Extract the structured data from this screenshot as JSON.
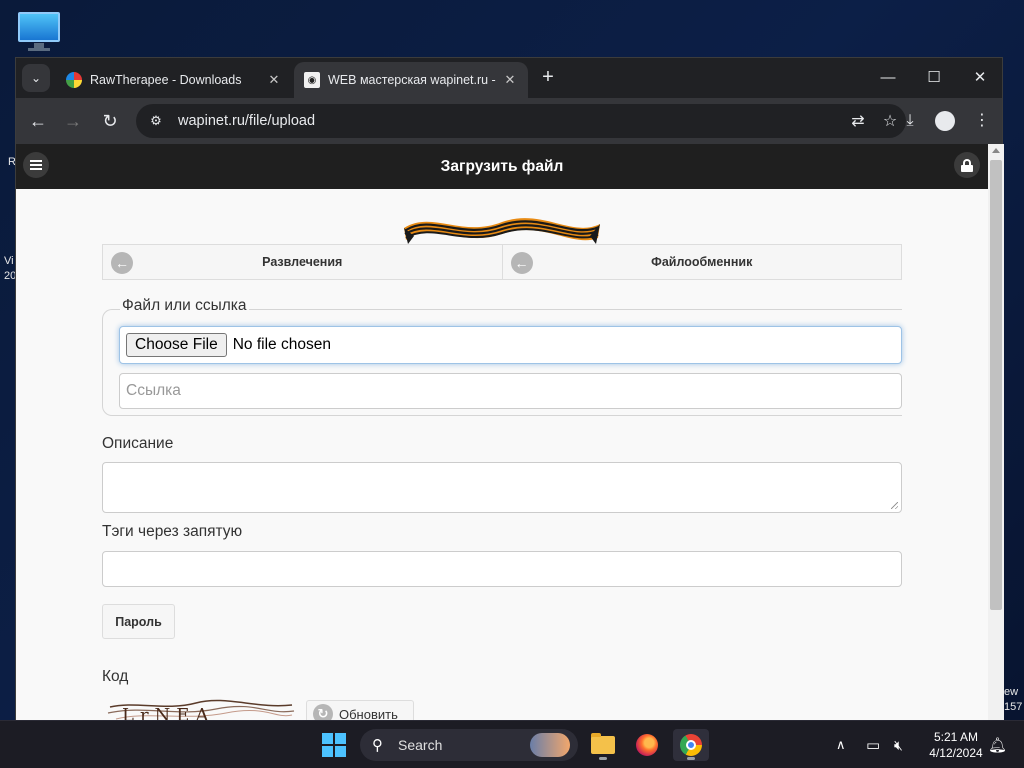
{
  "desktop": {
    "left_fragments": [
      "R",
      "Vi",
      "20"
    ],
    "right_fragments": [
      "ew",
      "157"
    ]
  },
  "browser": {
    "tabs": [
      {
        "title": "RawTherapee - Downloads",
        "close": "✕"
      },
      {
        "title": "WEB мастерская wapinet.ru - З",
        "close": "✕"
      }
    ],
    "new_tab": "+",
    "window_controls": {
      "minimize": "—",
      "maximize": "☐",
      "close": "✕"
    },
    "address": "wapinet.ru/file/upload"
  },
  "page": {
    "title": "Загрузить файл",
    "nav": [
      {
        "label": "Развлечения"
      },
      {
        "label": "Файлообменник"
      }
    ],
    "file_legend": "Файл или ссылка",
    "choose_file_label": "Choose File",
    "file_status": "No file chosen",
    "link_placeholder": "Ссылка",
    "description_label": "Описание",
    "tags_label": "Тэги через запятую",
    "password_button": "Пароль",
    "code_label": "Код",
    "refresh_label": "Обновить"
  },
  "taskbar": {
    "search_label": "Search",
    "time": "5:21 AM",
    "date": "4/12/2024"
  },
  "colors": {
    "header_bg": "#1f1f1f",
    "accent_focus": "#9ec3e6",
    "page_bg": "#f9f9f9"
  },
  "icons": [
    "monitor-icon",
    "tab-search-icon",
    "back-icon",
    "forward-icon",
    "reload-icon",
    "site-settings-icon",
    "translate-icon",
    "bookmark-star-icon",
    "download-icon",
    "profile-icon",
    "kebab-menu-icon",
    "hamburger-icon",
    "lock-icon",
    "arrow-left-circle-icon",
    "refresh-icon",
    "windows-start-icon",
    "search-icon",
    "file-explorer-icon",
    "firefox-icon",
    "chrome-icon",
    "chevron-up-icon",
    "network-icon",
    "volume-muted-icon",
    "notification-bell-icon"
  ]
}
